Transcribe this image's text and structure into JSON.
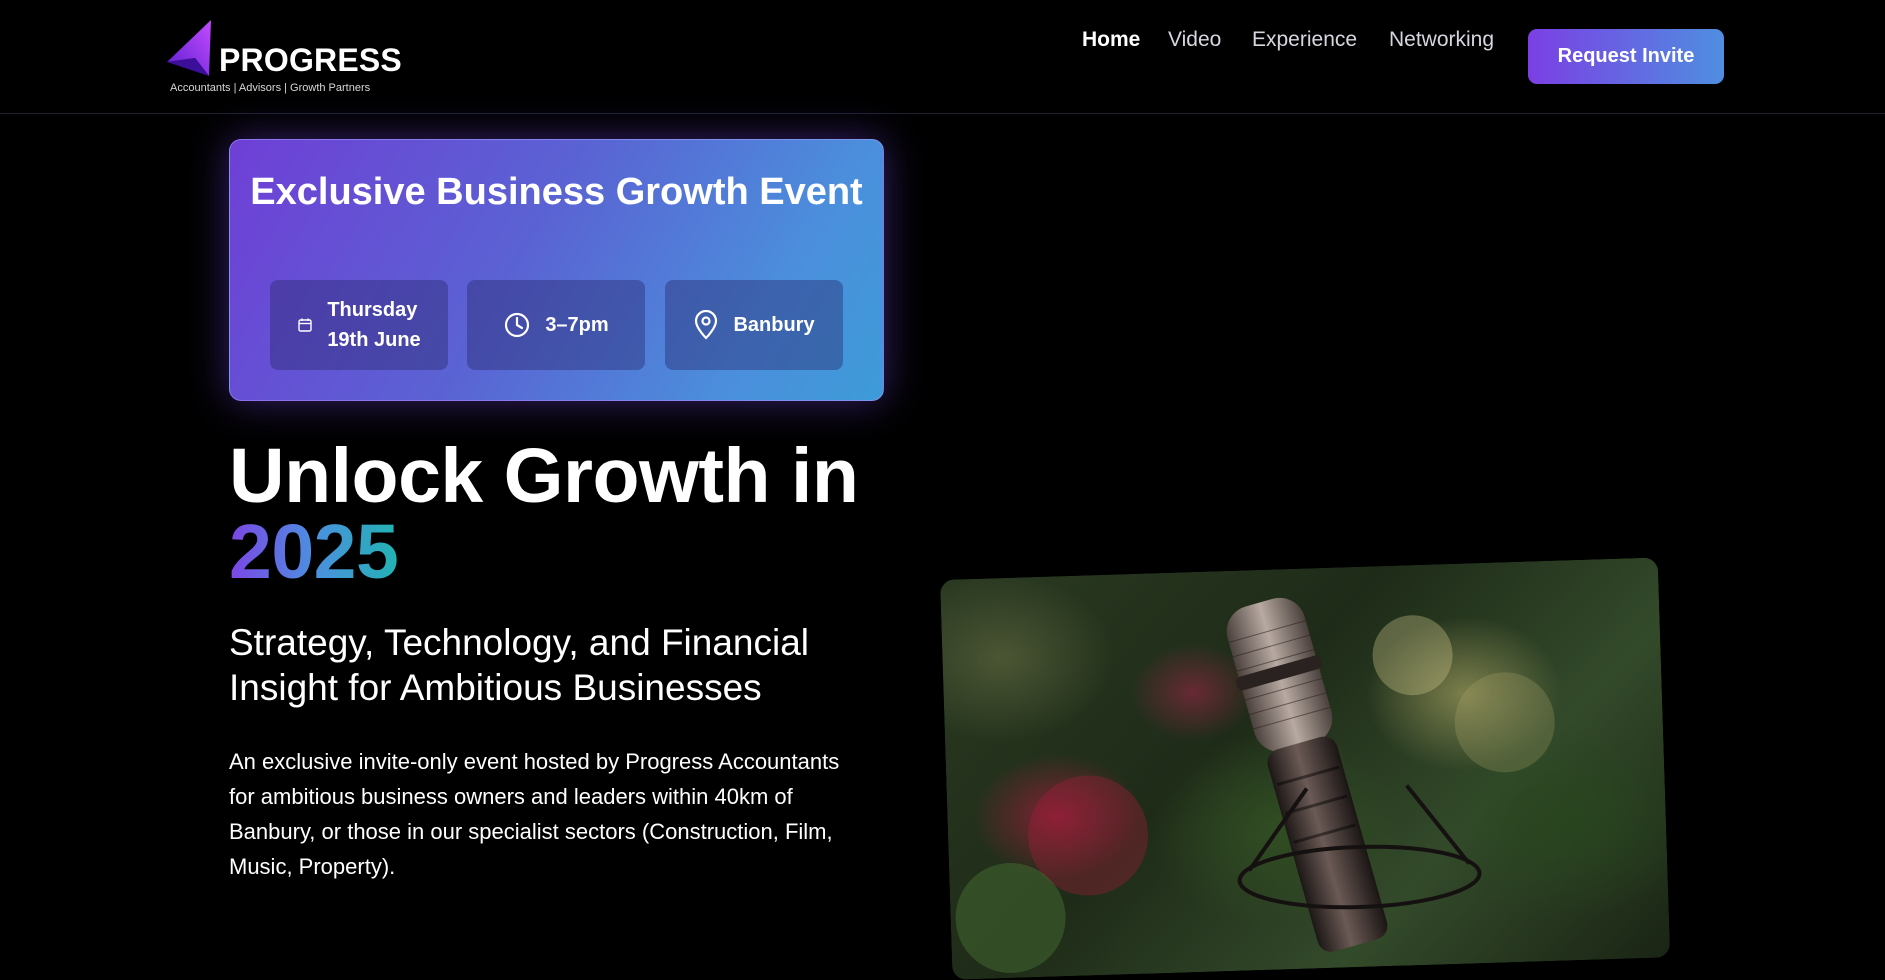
{
  "header": {
    "logo_word": "PROGRESS",
    "logo_tagline": "Accountants | Advisors | Growth Partners",
    "nav": [
      {
        "label": "Home",
        "active": true
      },
      {
        "label": "Video",
        "active": false
      },
      {
        "label": "Experience",
        "active": false
      },
      {
        "label": "Networking",
        "active": false
      }
    ],
    "cta_label": "Request Invite"
  },
  "event": {
    "title": "Exclusive Business Growth Event",
    "date_line1": "Thursday",
    "date_line2": "19th June",
    "time": "3–7pm",
    "location": "Banbury"
  },
  "hero": {
    "title_line1": "Unlock Growth in",
    "title_year": "2025",
    "subtitle": "Strategy, Technology, and Financial Insight for Ambitious Businesses",
    "description": "An exclusive invite-only event hosted by Progress Accountants for ambitious business owners and leaders within 40km of Banbury, or those in our specialist sectors (Construction, Film, Music, Property)."
  },
  "colors": {
    "accent_purple": "#7b3fe4",
    "accent_blue": "#4f8ee0",
    "accent_teal": "#22b3b3",
    "background": "#000000"
  },
  "icons": {
    "date": "calendar-icon",
    "time": "clock-icon",
    "location": "map-pin-icon"
  },
  "image": {
    "subject": "microphone-photo"
  }
}
